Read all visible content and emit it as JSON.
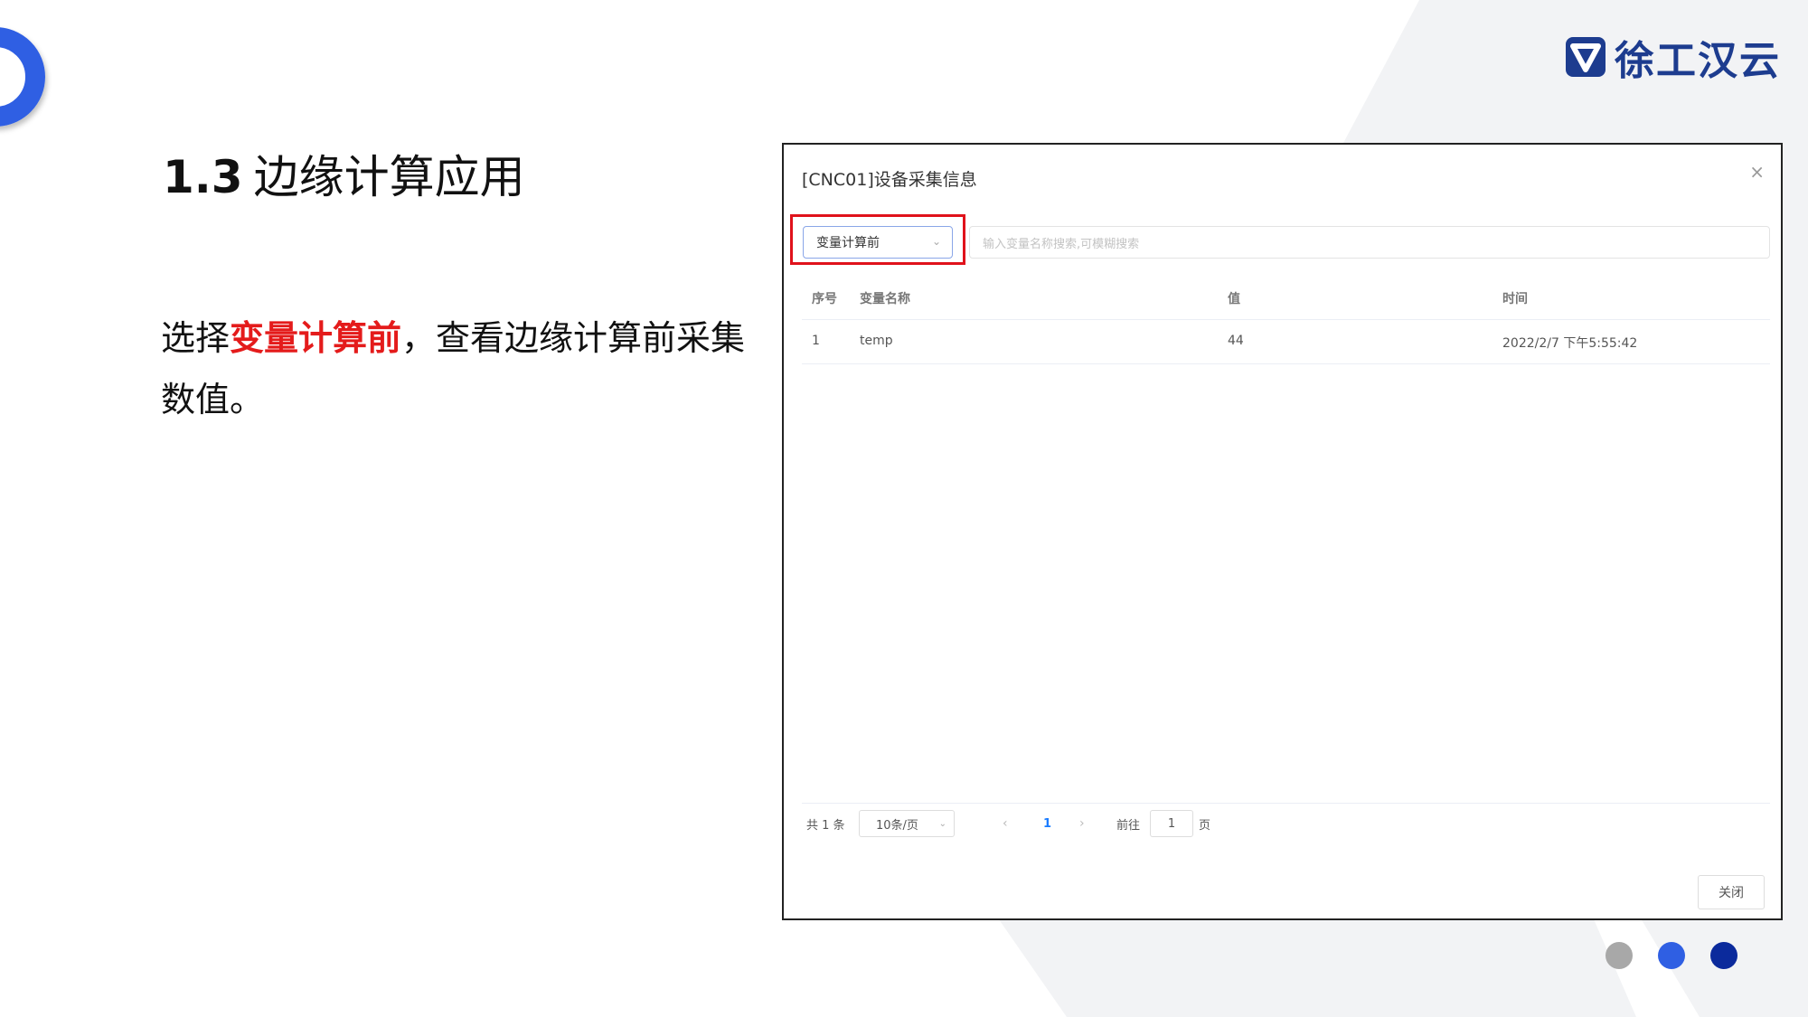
{
  "slide": {
    "heading_num": "1.3",
    "heading_text": "边缘计算应用",
    "desc_pre": "选择",
    "desc_highlight": "变量计算前",
    "desc_post": "，查看边缘计算前采集数值。"
  },
  "logo": {
    "text": "徐工汉云",
    "icon": "logo-shield-icon"
  },
  "colors": {
    "accent": "#2f5fe3",
    "highlight": "#e41b1b",
    "brand": "#1d3c8f",
    "dot1": "#a8a8a8",
    "dot2": "#2f5fe3",
    "dot3": "#0b2a9c"
  },
  "dialog": {
    "title": "[CNC01]设备采集信息",
    "close_icon": "×",
    "select_value": "变量计算前",
    "select_chevron": "⌄",
    "search_placeholder": "输入变量名称搜索,可模糊搜索",
    "columns": [
      "序号",
      "变量名称",
      "值",
      "时间"
    ],
    "rows": [
      [
        "1",
        "temp",
        "44",
        "2022/2/7 下午5:55:42"
      ]
    ],
    "pager": {
      "total": "共 1 条",
      "page_size": "10条/页",
      "prev": "‹",
      "current": "1",
      "next": "›",
      "goto": "前往",
      "goto_value": "1",
      "page_unit": "页"
    },
    "close_button": "关闭"
  }
}
